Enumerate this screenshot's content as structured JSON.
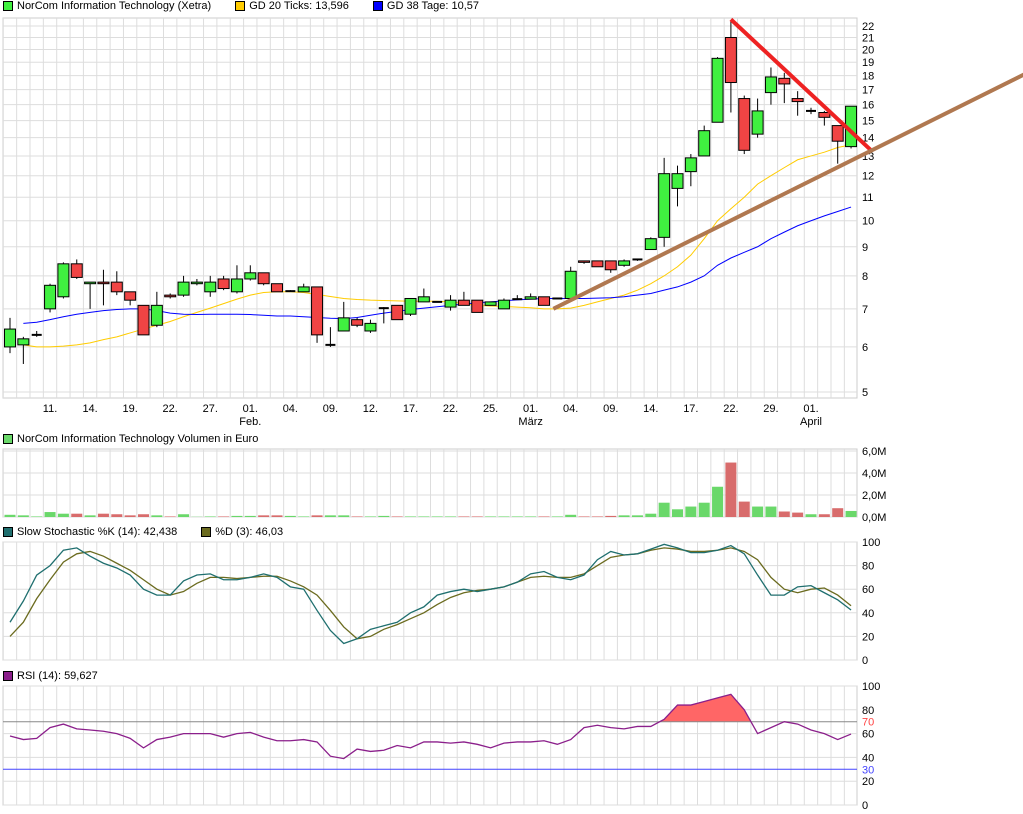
{
  "legend_main": {
    "price": "NorCom Information Technology (Xetra)",
    "gd20": "GD 20 Ticks: 13,596",
    "gd38": "GD 38 Tage: 10,57"
  },
  "legend_volume": "NorCom Information Technology Volumen in Euro",
  "legend_stoch": {
    "k": "Slow Stochastic %K (14): 42,438",
    "d": "%D (3): 46,03"
  },
  "legend_rsi": "RSI (14): 59,627",
  "colors": {
    "up": "#40f040",
    "down": "#f04444",
    "gd20": "#ffcc00",
    "gd38": "#0000ff",
    "vol_up": "#6ad86a",
    "vol_down": "#d86c6c",
    "stoch_k": "#1f6f6f",
    "stoch_d": "#6b6b1f",
    "rsi": "#8b1f8b",
    "red_trend": "#ee2222",
    "brown_trend": "#b07850"
  },
  "chart_data": [
    {
      "type": "candlestick",
      "scale": "log",
      "ylim": [
        4.7,
        23
      ],
      "yticks": [
        "5",
        "6",
        "7",
        "8",
        "9",
        "10",
        "11",
        "12",
        "13",
        "14",
        "15",
        "16",
        "17",
        "18",
        "19",
        "20",
        "21",
        "22"
      ],
      "xticks": [
        {
          "i": 3,
          "label": "11."
        },
        {
          "i": 6,
          "label": "14."
        },
        {
          "i": 9,
          "label": "19."
        },
        {
          "i": 12,
          "label": "22."
        },
        {
          "i": 15,
          "label": "27."
        },
        {
          "i": 18,
          "label": "01.",
          "sub": "Feb."
        },
        {
          "i": 21,
          "label": "04."
        },
        {
          "i": 24,
          "label": "09."
        },
        {
          "i": 27,
          "label": "12."
        },
        {
          "i": 30,
          "label": "17."
        },
        {
          "i": 33,
          "label": "22."
        },
        {
          "i": 36,
          "label": "25."
        },
        {
          "i": 39,
          "label": "01.",
          "sub": "März"
        },
        {
          "i": 42,
          "label": "04."
        },
        {
          "i": 45,
          "label": "09."
        },
        {
          "i": 48,
          "label": "14."
        },
        {
          "i": 51,
          "label": "17."
        },
        {
          "i": 54,
          "label": "22."
        },
        {
          "i": 57,
          "label": "29."
        },
        {
          "i": 60,
          "label": "01.",
          "sub": "April"
        }
      ],
      "ohlc": [
        [
          6.0,
          6.75,
          5.85,
          6.45
        ],
        [
          6.05,
          6.25,
          5.6,
          6.2
        ],
        [
          6.3,
          6.4,
          6.25,
          6.3
        ],
        [
          7.0,
          7.75,
          6.9,
          7.7
        ],
        [
          7.35,
          8.45,
          7.3,
          8.4
        ],
        [
          8.4,
          8.55,
          7.9,
          7.95
        ],
        [
          7.75,
          7.8,
          7.0,
          7.8
        ],
        [
          7.8,
          8.2,
          7.1,
          7.75
        ],
        [
          7.8,
          8.15,
          7.4,
          7.5
        ],
        [
          7.5,
          7.5,
          7.1,
          7.25
        ],
        [
          7.1,
          7.1,
          6.3,
          6.3
        ],
        [
          6.55,
          7.5,
          6.5,
          7.1
        ],
        [
          7.4,
          7.45,
          7.3,
          7.35
        ],
        [
          7.4,
          8.0,
          7.35,
          7.8
        ],
        [
          7.75,
          7.9,
          7.7,
          7.8
        ],
        [
          7.5,
          8.0,
          7.35,
          7.8
        ],
        [
          7.9,
          8.0,
          7.55,
          7.6
        ],
        [
          7.5,
          8.35,
          7.45,
          7.9
        ],
        [
          7.9,
          8.35,
          7.85,
          8.1
        ],
        [
          8.1,
          8.1,
          7.7,
          7.75
        ],
        [
          7.75,
          7.75,
          7.5,
          7.5
        ],
        [
          7.52,
          7.55,
          7.5,
          7.52
        ],
        [
          7.5,
          7.75,
          7.5,
          7.65
        ],
        [
          7.65,
          7.65,
          6.1,
          6.3
        ],
        [
          6.05,
          6.5,
          6.0,
          6.05
        ],
        [
          6.4,
          7.2,
          6.4,
          6.75
        ],
        [
          6.7,
          6.75,
          6.5,
          6.55
        ],
        [
          6.4,
          6.7,
          6.35,
          6.6
        ],
        [
          7.02,
          7.05,
          6.6,
          7.02
        ],
        [
          7.1,
          7.1,
          6.7,
          6.7
        ],
        [
          6.85,
          7.3,
          6.8,
          7.3
        ],
        [
          7.2,
          7.6,
          7.2,
          7.35
        ],
        [
          7.2,
          7.2,
          7.2,
          7.2
        ],
        [
          7.05,
          7.4,
          6.95,
          7.25
        ],
        [
          7.25,
          7.5,
          7.1,
          7.1
        ],
        [
          7.25,
          7.25,
          6.9,
          6.9
        ],
        [
          7.1,
          7.2,
          7.1,
          7.2
        ],
        [
          7.0,
          7.3,
          7.0,
          7.25
        ],
        [
          7.28,
          7.4,
          7.28,
          7.28
        ],
        [
          7.28,
          7.45,
          7.28,
          7.35
        ],
        [
          7.35,
          7.35,
          7.1,
          7.1
        ],
        [
          7.3,
          7.3,
          7.3,
          7.3
        ],
        [
          7.3,
          8.3,
          7.3,
          8.15
        ],
        [
          8.5,
          8.5,
          8.4,
          8.45
        ],
        [
          8.5,
          8.5,
          8.3,
          8.3
        ],
        [
          8.5,
          8.5,
          8.1,
          8.2
        ],
        [
          8.35,
          8.55,
          8.3,
          8.5
        ],
        [
          8.55,
          8.58,
          8.5,
          8.55
        ],
        [
          8.9,
          9.35,
          8.9,
          9.3
        ],
        [
          9.35,
          12.9,
          9.0,
          12.1
        ],
        [
          11.4,
          12.5,
          10.6,
          12.1
        ],
        [
          12.2,
          13.1,
          11.5,
          12.9
        ],
        [
          13.0,
          14.7,
          13.0,
          14.4
        ],
        [
          14.9,
          19.4,
          14.9,
          19.3
        ],
        [
          21.0,
          22.5,
          15.5,
          17.5
        ],
        [
          16.4,
          16.6,
          13.1,
          13.3
        ],
        [
          14.2,
          16.4,
          14.0,
          15.6
        ],
        [
          16.8,
          18.6,
          16.0,
          17.9
        ],
        [
          17.8,
          18.2,
          16.1,
          17.4
        ],
        [
          16.4,
          16.9,
          15.3,
          16.2
        ],
        [
          15.6,
          15.8,
          15.4,
          15.6
        ],
        [
          15.5,
          15.6,
          14.7,
          15.2
        ],
        [
          14.7,
          14.7,
          12.6,
          13.8
        ],
        [
          13.5,
          15.9,
          13.4,
          15.9
        ]
      ],
      "gd20": [
        6.05,
        6.0,
        6.0,
        6.02,
        6.05,
        6.1,
        6.18,
        6.25,
        6.35,
        6.45,
        6.55,
        6.65,
        6.78,
        6.9,
        7.02,
        7.15,
        7.28,
        7.4,
        7.48,
        7.5,
        7.5,
        7.48,
        7.42,
        7.36,
        7.3,
        7.27,
        7.25,
        7.24,
        7.23,
        7.22,
        7.22,
        7.22,
        7.2,
        7.15,
        7.1,
        7.08,
        7.07,
        7.05,
        7.03,
        7.0,
        7.0,
        7.02,
        7.1,
        7.2,
        7.3,
        7.4,
        7.55,
        7.75,
        8.0,
        8.3,
        8.7,
        9.3,
        10.0,
        10.5,
        11.0,
        11.6,
        12.0,
        12.4,
        12.8,
        13.0,
        13.2,
        13.45,
        13.6
      ],
      "gd38": [
        6.6,
        6.63,
        6.7,
        6.78,
        6.85,
        6.9,
        6.95,
        6.98,
        7.0,
        7.0,
        6.95,
        6.88,
        6.85,
        6.84,
        6.85,
        6.85,
        6.85,
        6.84,
        6.82,
        6.8,
        6.8,
        6.78,
        6.76,
        6.74,
        6.73,
        6.76,
        6.82,
        6.88,
        6.93,
        6.98,
        7.02,
        7.06,
        7.1,
        7.14,
        7.17,
        7.2,
        7.23,
        7.26,
        7.28,
        7.3,
        7.3,
        7.3,
        7.3,
        7.31,
        7.32,
        7.35,
        7.4,
        7.45,
        7.55,
        7.65,
        7.8,
        8.0,
        8.35,
        8.6,
        8.8,
        9.0,
        9.3,
        9.55,
        9.8,
        10.0,
        10.2,
        10.38,
        10.57
      ],
      "trendlines": [
        {
          "name": "red",
          "from": [
            54,
            22.6
          ],
          "to": [
            64.5,
            13.3
          ]
        },
        {
          "name": "brown",
          "from": [
            40.7,
            7.0
          ],
          "to": [
            76,
            18.1
          ]
        }
      ]
    },
    {
      "type": "bar",
      "title": "Volumen in Euro",
      "unit": "M",
      "ylim": [
        0,
        6
      ],
      "yticks": [
        "0,0M",
        "2,0M",
        "4,0M",
        "6,0M"
      ],
      "values": [
        0.2,
        0.15,
        0.05,
        0.45,
        0.3,
        0.3,
        0.15,
        0.3,
        0.25,
        0.15,
        0.25,
        0.15,
        0.05,
        0.25,
        0.02,
        0.05,
        0.05,
        0.1,
        0.1,
        0.15,
        0.15,
        0.1,
        0.05,
        0.15,
        0.15,
        0.15,
        0.05,
        0.05,
        0.1,
        0.05,
        0.05,
        0.05,
        0.05,
        0.05,
        0.05,
        0.05,
        0.05,
        0.05,
        0.05,
        0.05,
        0.05,
        0.05,
        0.2,
        0.05,
        0.05,
        0.1,
        0.15,
        0.15,
        0.3,
        1.3,
        0.7,
        0.95,
        1.3,
        2.75,
        4.95,
        1.4,
        0.95,
        0.95,
        0.5,
        0.4,
        0.25,
        0.25,
        0.8,
        0.55
      ]
    },
    {
      "type": "line",
      "title": "Slow Stochastic",
      "ylim": [
        0,
        100
      ],
      "yticks": [
        "0",
        "20",
        "40",
        "60",
        "80",
        "100"
      ],
      "series": [
        {
          "name": "%K",
          "values": [
            32,
            50,
            72,
            80,
            93,
            95,
            88,
            82,
            78,
            72,
            60,
            55,
            55,
            67,
            72,
            73,
            68,
            68,
            70,
            73,
            70,
            62,
            60,
            42,
            25,
            14,
            18,
            26,
            29,
            32,
            40,
            45,
            55,
            58,
            60,
            58,
            60,
            62,
            66,
            73,
            75,
            70,
            68,
            72,
            85,
            92,
            89,
            90,
            94,
            98,
            95,
            91,
            91,
            93,
            97,
            90,
            72,
            55,
            55,
            62,
            63,
            57,
            51,
            42.4
          ]
        },
        {
          "name": "%D",
          "values": [
            20,
            32,
            52,
            68,
            83,
            90,
            92,
            88,
            82,
            76,
            68,
            60,
            55,
            58,
            65,
            70,
            70,
            69,
            70,
            71,
            71,
            67,
            62,
            55,
            42,
            28,
            18,
            20,
            26,
            30,
            35,
            40,
            47,
            53,
            57,
            59,
            60,
            62,
            66,
            70,
            71,
            70,
            70,
            73,
            80,
            87,
            89,
            90,
            93,
            95,
            94,
            92,
            92,
            93,
            95,
            92,
            85,
            70,
            60,
            57,
            60,
            61,
            55,
            46
          ]
        }
      ]
    },
    {
      "type": "line",
      "title": "RSI (14)",
      "ylim": [
        0,
        100
      ],
      "yticks": [
        "0",
        "20",
        "40",
        "60",
        "80",
        "100"
      ],
      "levels": [
        {
          "value": 70,
          "label": "70",
          "color": "#ff4444"
        },
        {
          "value": 30,
          "label": "30",
          "color": "#4444ff"
        }
      ],
      "values": [
        58,
        55,
        56,
        65,
        68,
        64,
        63,
        62,
        60,
        56,
        48,
        55,
        57,
        60,
        60,
        60,
        57,
        60,
        61,
        57,
        54,
        54,
        55,
        53,
        41,
        39,
        47,
        45,
        46,
        50,
        48,
        53,
        53,
        52,
        53,
        51,
        48,
        52,
        53,
        53,
        54,
        51,
        55,
        65,
        67,
        65,
        64,
        66,
        66,
        72,
        84,
        84,
        87,
        90,
        93,
        80,
        60,
        65,
        70,
        68,
        63,
        60,
        55,
        59.6
      ]
    }
  ]
}
